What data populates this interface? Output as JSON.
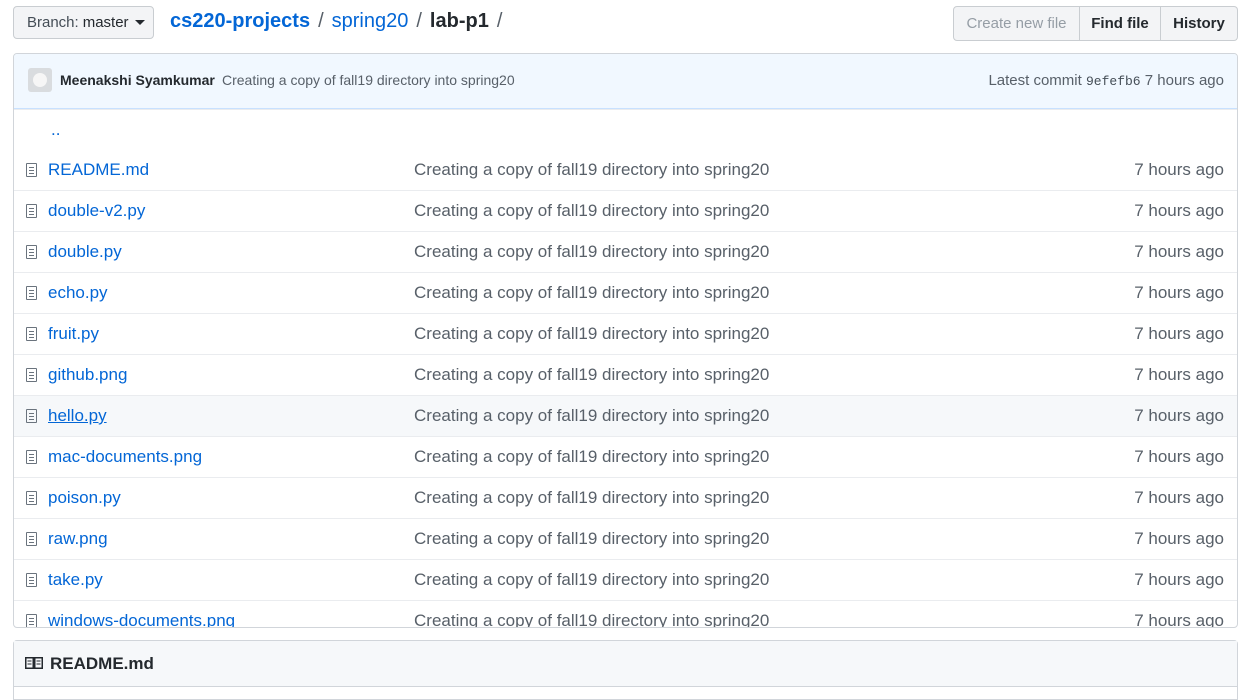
{
  "branch": {
    "label": "Branch:",
    "value": "master"
  },
  "breadcrumb": {
    "repo": "cs220-projects",
    "sep1": "/",
    "dir": "spring20",
    "sep2": "/",
    "current": "lab-p1",
    "sep3": "/"
  },
  "buttons": {
    "create": "Create new file",
    "find": "Find file",
    "history": "History"
  },
  "commit": {
    "author": "Meenakshi Syamkumar",
    "message": "Creating a copy of fall19 directory into spring20",
    "latest_label": "Latest commit",
    "sha": "9efefb6",
    "age": "7 hours ago"
  },
  "updir": "..",
  "files": [
    {
      "name": "README.md",
      "message": "Creating a copy of fall19 directory into spring20",
      "age": "7 hours ago"
    },
    {
      "name": "double-v2.py",
      "message": "Creating a copy of fall19 directory into spring20",
      "age": "7 hours ago"
    },
    {
      "name": "double.py",
      "message": "Creating a copy of fall19 directory into spring20",
      "age": "7 hours ago"
    },
    {
      "name": "echo.py",
      "message": "Creating a copy of fall19 directory into spring20",
      "age": "7 hours ago"
    },
    {
      "name": "fruit.py",
      "message": "Creating a copy of fall19 directory into spring20",
      "age": "7 hours ago"
    },
    {
      "name": "github.png",
      "message": "Creating a copy of fall19 directory into spring20",
      "age": "7 hours ago"
    },
    {
      "name": "hello.py",
      "message": "Creating a copy of fall19 directory into spring20",
      "age": "7 hours ago"
    },
    {
      "name": "mac-documents.png",
      "message": "Creating a copy of fall19 directory into spring20",
      "age": "7 hours ago"
    },
    {
      "name": "poison.py",
      "message": "Creating a copy of fall19 directory into spring20",
      "age": "7 hours ago"
    },
    {
      "name": "raw.png",
      "message": "Creating a copy of fall19 directory into spring20",
      "age": "7 hours ago"
    },
    {
      "name": "take.py",
      "message": "Creating a copy of fall19 directory into spring20",
      "age": "7 hours ago"
    },
    {
      "name": "windows-documents.png",
      "message": "Creating a copy of fall19 directory into spring20",
      "age": "7 hours ago"
    }
  ],
  "readme": {
    "title": "README.md"
  },
  "icons": {
    "file": "file-icon",
    "book": "book-icon",
    "caret": "caret-down-icon"
  },
  "colors": {
    "link": "#0366d6",
    "muted": "#586069",
    "commit_bg": "#f1f8ff"
  }
}
